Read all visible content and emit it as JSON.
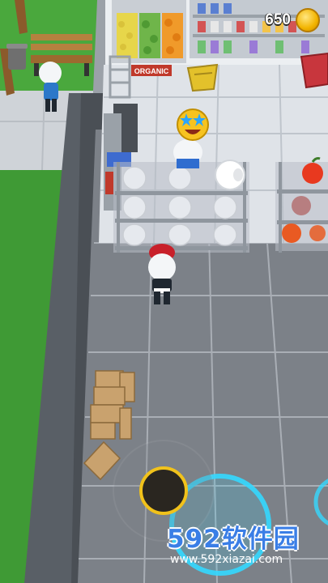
{
  "hud": {
    "coins": "650",
    "coin_icon": "gold-coin-icon"
  },
  "scene": {
    "organic_sign": "ORGANIC",
    "npc_emoji": "star-struck-emoji-icon"
  },
  "joystick": {
    "icon": "virtual-joystick"
  },
  "watermark": {
    "brand": "592软件园",
    "url": "www.592xiazai.com"
  },
  "colors": {
    "floor": "#7c8188",
    "store_floor": "#dfe3e8",
    "grass": "#3f9a35",
    "joystick_glow": "#34d8ff",
    "coin": "#f2b400"
  }
}
